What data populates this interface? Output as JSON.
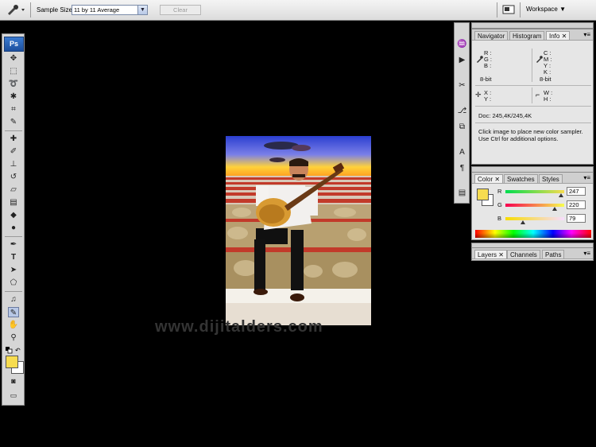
{
  "options_bar": {
    "sample_size_label": "Sample Size:",
    "sample_size_value": "11 by 11 Average",
    "clear_label": "Clear",
    "workspace_label": "Workspace ▼"
  },
  "toolbox": {
    "logo": "Ps",
    "foreground_color": "#f7dc4f",
    "background_color": "#ffffff"
  },
  "info_panel": {
    "tabs": [
      "Navigator",
      "Histogram",
      "Info"
    ],
    "active_tab": "Info",
    "r_label": "R :",
    "g_label": "G :",
    "b_label": "B :",
    "c_label": "C :",
    "m_label": "M :",
    "y_label": "Y :",
    "k_label": "K :",
    "bit_left": "8-bit",
    "bit_right": "8-bit",
    "x_label": "X :",
    "yy_label": "Y :",
    "w_label": "W :",
    "h_label": "H :",
    "doc": "Doc: 245,4K/245,4K",
    "help_line1": "Click image to place new color sampler.",
    "help_line2": "Use Ctrl for additional options."
  },
  "color_panel": {
    "tabs": [
      "Color",
      "Swatches",
      "Styles"
    ],
    "active_tab": "Color",
    "r_label": "R",
    "g_label": "G",
    "b_label": "B",
    "r_value": "247",
    "g_value": "220",
    "b_value": "79",
    "swatch_color": "#f7dc4f"
  },
  "layers_panel": {
    "tabs": [
      "Layers",
      "Channels",
      "Paths"
    ],
    "active_tab": "Layers"
  },
  "canvas": {
    "watermark": "www.dijitalders.com"
  }
}
